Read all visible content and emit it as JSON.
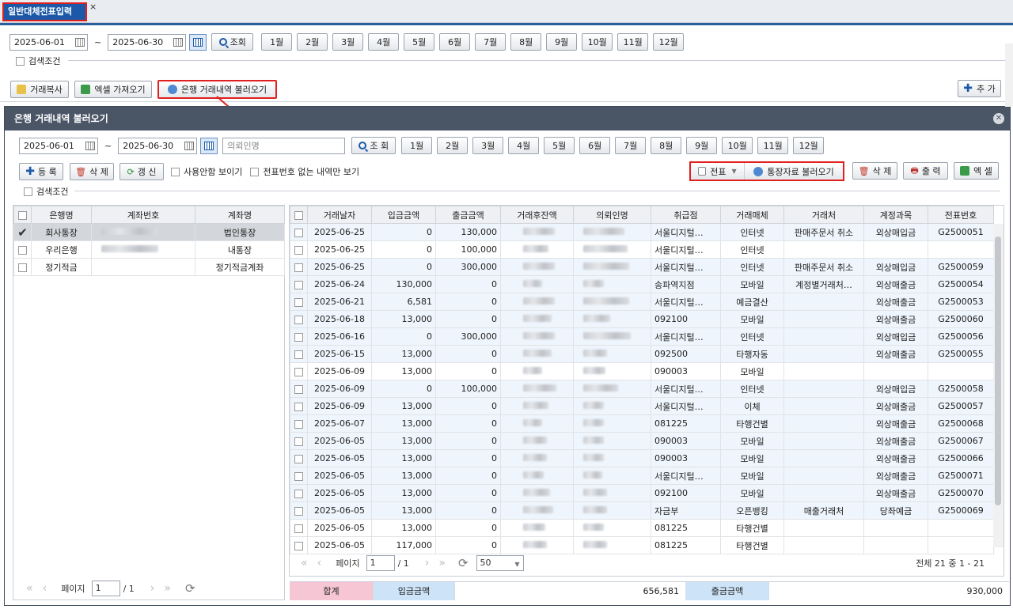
{
  "tab": {
    "title": "일반대체전표입력",
    "close": "×"
  },
  "main": {
    "date_from": "2025-06-01",
    "date_to": "2025-06-30",
    "tilde": "~",
    "search_label": "조회",
    "months": [
      "1월",
      "2월",
      "3월",
      "4월",
      "5월",
      "6월",
      "7월",
      "8월",
      "9월",
      "10월",
      "11월",
      "12월"
    ],
    "search_condition": "검색조건",
    "copy_btn": "거래복사",
    "excel_btn": "엑셀 가져오기",
    "bank_btn": "은행 거래내역 불러오기",
    "add_btn": "추 가"
  },
  "dialog": {
    "title": "은행 거래내역 불러오기",
    "date_from": "2025-06-01",
    "date_to": "2025-06-30",
    "tilde": "~",
    "payer_placeholder": "의뢰인명",
    "search_label": "조 회",
    "months": [
      "1월",
      "2월",
      "3월",
      "4월",
      "5월",
      "6월",
      "7월",
      "8월",
      "9월",
      "10월",
      "11월",
      "12월"
    ],
    "register_btn": "등 록",
    "delete_btn": "삭 제",
    "refresh_btn": "갱 신",
    "show_unused": "사용안함 보이기",
    "show_no_voucher": "전표번호 없는 내역만 보기",
    "voucher_btn": "전표",
    "load_passbook_btn": "통장자료 불러오기",
    "delete2_btn": "삭 제",
    "print_btn": "출 력",
    "excel_btn": "엑 셀",
    "search_condition": "검색조건"
  },
  "accounts": {
    "headers": [
      "은행명",
      "계좌번호",
      "계좌명"
    ],
    "rows": [
      {
        "bank": "회사통장",
        "name": "법인통장",
        "checked": true
      },
      {
        "bank": "우리은행",
        "name": "내통장",
        "checked": false
      },
      {
        "bank": "정기적금",
        "name": "정기적금계좌",
        "checked": false
      }
    ],
    "pager": {
      "page_label": "페이지",
      "page": "1",
      "total": "/ 1"
    }
  },
  "transactions": {
    "headers": [
      "거래날자",
      "입금금액",
      "출금금액",
      "거래후잔액",
      "의뢰인명",
      "취급점",
      "거래매체",
      "거래처",
      "계정과목",
      "전표번호"
    ],
    "rows": [
      [
        "2025-06-25",
        "0",
        "130,000",
        "서울디지털…",
        "인터넷",
        "판매주문서 취소",
        "외상매입금",
        "G2500051"
      ],
      [
        "2025-06-25",
        "0",
        "100,000",
        "서울디지털…",
        "인터넷",
        "",
        "",
        ""
      ],
      [
        "2025-06-25",
        "0",
        "300,000",
        "서울디지털…",
        "인터넷",
        "판매주문서 취소",
        "외상매입금",
        "G2500059"
      ],
      [
        "2025-06-24",
        "130,000",
        "0",
        "송파역지점",
        "모바일",
        "계정별거래처…",
        "외상매출금",
        "G2500054"
      ],
      [
        "2025-06-21",
        "6,581",
        "0",
        "서울디지털…",
        "예금결산",
        "",
        "외상매출금",
        "G2500053"
      ],
      [
        "2025-06-18",
        "13,000",
        "0",
        "092100",
        "모바일",
        "",
        "외상매출금",
        "G2500060"
      ],
      [
        "2025-06-16",
        "0",
        "300,000",
        "서울디지털…",
        "인터넷",
        "",
        "외상매입금",
        "G2500056"
      ],
      [
        "2025-06-15",
        "13,000",
        "0",
        "092500",
        "타행자동",
        "",
        "외상매출금",
        "G2500055"
      ],
      [
        "2025-06-09",
        "13,000",
        "0",
        "090003",
        "모바일",
        "",
        "",
        ""
      ],
      [
        "2025-06-09",
        "0",
        "100,000",
        "서울디지털…",
        "인터넷",
        "",
        "외상매입금",
        "G2500058"
      ],
      [
        "2025-06-09",
        "13,000",
        "0",
        "서울디지털…",
        "이체",
        "",
        "외상매출금",
        "G2500057"
      ],
      [
        "2025-06-07",
        "13,000",
        "0",
        "081225",
        "타행건별",
        "",
        "외상매출금",
        "G2500068"
      ],
      [
        "2025-06-05",
        "13,000",
        "0",
        "090003",
        "모바일",
        "",
        "외상매출금",
        "G2500067"
      ],
      [
        "2025-06-05",
        "13,000",
        "0",
        "090003",
        "모바일",
        "",
        "외상매출금",
        "G2500066"
      ],
      [
        "2025-06-05",
        "13,000",
        "0",
        "서울디지털…",
        "모바일",
        "",
        "외상매출금",
        "G2500071"
      ],
      [
        "2025-06-05",
        "13,000",
        "0",
        "092100",
        "모바일",
        "",
        "외상매출금",
        "G2500070"
      ],
      [
        "2025-06-05",
        "13,000",
        "0",
        "자금부",
        "오픈뱅킹",
        "매출거래처",
        "당좌예금",
        "G2500069"
      ],
      [
        "2025-06-05",
        "13,000",
        "0",
        "081225",
        "타행건별",
        "",
        "",
        ""
      ],
      [
        "2025-06-05",
        "117,000",
        "0",
        "081225",
        "타행건별",
        "",
        "",
        ""
      ]
    ],
    "pager": {
      "page_label": "페이지",
      "page": "1",
      "total": "/ 1",
      "page_size": "50",
      "summary": "전체 21 중 1 - 21"
    }
  },
  "totals": {
    "label": "합계",
    "deposit_label": "입금금액",
    "deposit_value": "656,581",
    "withdraw_label": "출금금액",
    "withdraw_value": "930,000"
  },
  "colors": {
    "accent": "#1b59a8",
    "highlight": "#e0201e",
    "dialog_header": "#4a5566"
  }
}
